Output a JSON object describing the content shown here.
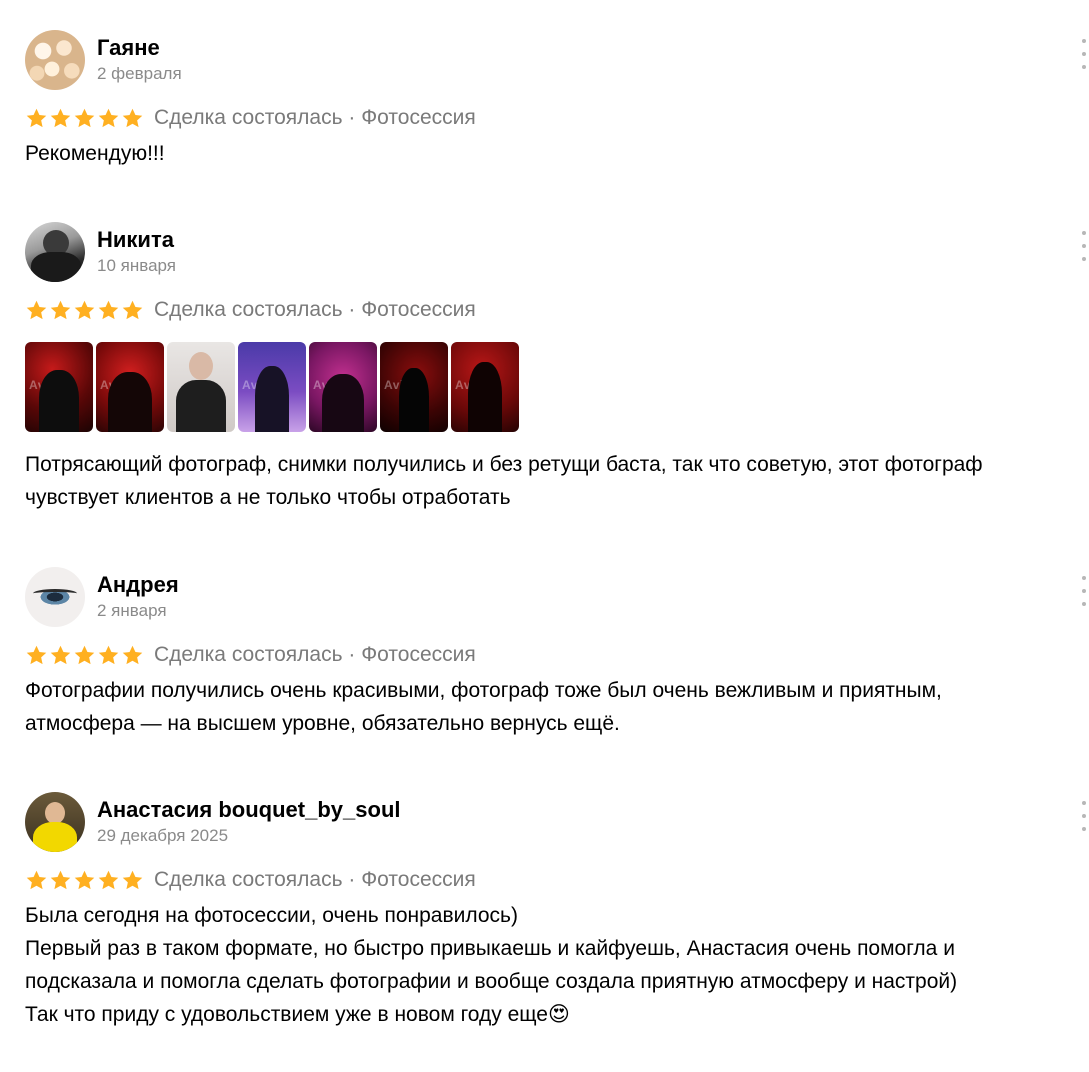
{
  "reviews": [
    {
      "name": "Гаяне",
      "date": "2 февраля",
      "rating": 5,
      "deal": "Сделка состоялась · Фотосессия",
      "text": "Рекомендую!!!",
      "avatar_icon": "flowers-avatar"
    },
    {
      "name": "Никита",
      "date": "10 января",
      "rating": 5,
      "deal": "Сделка состоялась · Фотосессия",
      "text": "Потрясающий фотограф, снимки получились и без ретущи баста, так что советую, этот фотограф\nчувствует клиентов а не только чтобы отработать",
      "avatar_icon": "photographer-avatar",
      "photo_watermark": "Avito",
      "photos": [
        {
          "icon": "photo-red-portrait"
        },
        {
          "icon": "photo-red-portrait-2"
        },
        {
          "icon": "photo-light-portrait"
        },
        {
          "icon": "photo-purple-portrait"
        },
        {
          "icon": "photo-magenta-portrait"
        },
        {
          "icon": "photo-dark-red-portrait"
        },
        {
          "icon": "photo-red-standing"
        }
      ]
    },
    {
      "name": "Андрея",
      "date": "2 января",
      "rating": 5,
      "deal": "Сделка состоялась · Фотосессия",
      "text": "Фотографии получились очень красивыми, фотограф тоже был очень вежливым и приятным,\nатмосфера — на высшем уровне, обязательно вернусь ещё.",
      "avatar_icon": "eye-avatar"
    },
    {
      "name": "Анастасия bouquet_by_soul",
      "date": "29 декабря 2025",
      "rating": 5,
      "deal": "Сделка состоялась · Фотосессия",
      "text": "Была сегодня на фотосессии, очень понравилось)\nПервый раз в таком формате, но быстро привыкаешь и кайфуешь, Анастасия очень помогла и\nподсказала и помогла сделать фотографии и вообще создала приятную атмосферу и настрой)\nТак что приду с удовольствием уже в новом году еще😍",
      "avatar_icon": "woman-yellow-avatar"
    }
  ],
  "colors": {
    "star": "#FFB021",
    "meta_text": "#7a7a7a",
    "date_text": "#8a8a8a"
  }
}
